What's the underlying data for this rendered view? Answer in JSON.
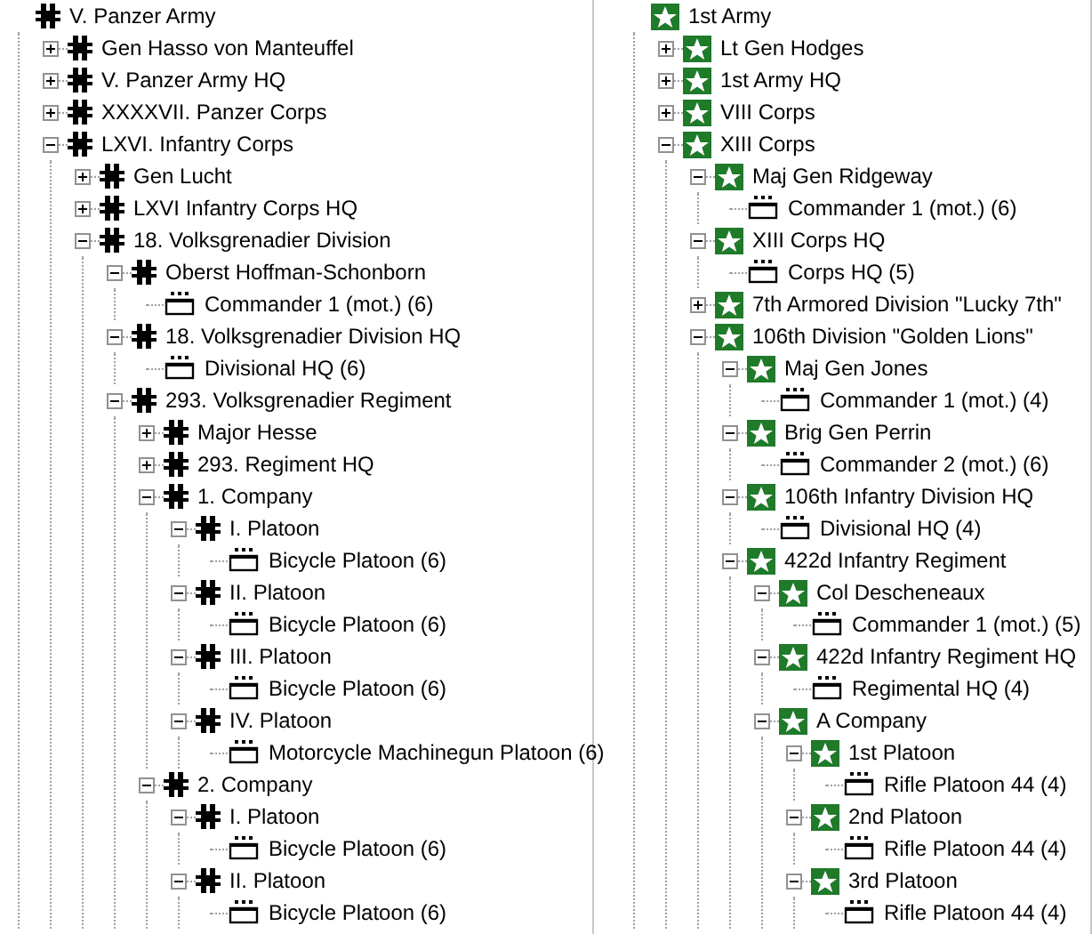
{
  "panes": [
    {
      "tree": {
        "label": "V. Panzer Army",
        "kind": "german",
        "children": [
          {
            "label": "Gen Hasso von Manteuffel",
            "kind": "german",
            "expanded": false
          },
          {
            "label": "V. Panzer Army HQ",
            "kind": "german",
            "expanded": false
          },
          {
            "label": "XXXXVII. Panzer Corps",
            "kind": "german",
            "expanded": false
          },
          {
            "label": "LXVI. Infantry Corps",
            "kind": "german",
            "expanded": true,
            "children": [
              {
                "label": "Gen Lucht",
                "kind": "german",
                "expanded": false
              },
              {
                "label": "LXVI Infantry Corps HQ",
                "kind": "german",
                "expanded": false
              },
              {
                "label": "18. Volksgrenadier Division",
                "kind": "german",
                "expanded": true,
                "children": [
                  {
                    "label": "Oberst Hoffman-Schonborn",
                    "kind": "german",
                    "expanded": true,
                    "children": [
                      {
                        "label": "Commander 1 (mot.) (6)",
                        "kind": "unit"
                      }
                    ]
                  },
                  {
                    "label": "18. Volksgrenadier Division HQ",
                    "kind": "german",
                    "expanded": true,
                    "children": [
                      {
                        "label": "Divisional HQ (6)",
                        "kind": "unit"
                      }
                    ]
                  },
                  {
                    "label": "293. Volksgrenadier Regiment",
                    "kind": "german",
                    "expanded": true,
                    "children": [
                      {
                        "label": "Major Hesse",
                        "kind": "german",
                        "expanded": false
                      },
                      {
                        "label": "293. Regiment HQ",
                        "kind": "german",
                        "expanded": false
                      },
                      {
                        "label": "1. Company",
                        "kind": "german",
                        "expanded": true,
                        "children": [
                          {
                            "label": "I. Platoon",
                            "kind": "german",
                            "expanded": true,
                            "children": [
                              {
                                "label": "Bicycle Platoon (6)",
                                "kind": "unit"
                              }
                            ]
                          },
                          {
                            "label": "II. Platoon",
                            "kind": "german",
                            "expanded": true,
                            "children": [
                              {
                                "label": "Bicycle Platoon (6)",
                                "kind": "unit"
                              }
                            ]
                          },
                          {
                            "label": "III. Platoon",
                            "kind": "german",
                            "expanded": true,
                            "children": [
                              {
                                "label": "Bicycle Platoon (6)",
                                "kind": "unit"
                              }
                            ]
                          },
                          {
                            "label": "IV. Platoon",
                            "kind": "german",
                            "expanded": true,
                            "children": [
                              {
                                "label": "Motorcycle Machinegun Platoon (6)",
                                "kind": "unit"
                              }
                            ]
                          }
                        ]
                      },
                      {
                        "label": "2. Company",
                        "kind": "german",
                        "expanded": true,
                        "children": [
                          {
                            "label": "I. Platoon",
                            "kind": "german",
                            "expanded": true,
                            "children": [
                              {
                                "label": "Bicycle Platoon (6)",
                                "kind": "unit"
                              }
                            ]
                          },
                          {
                            "label": "II. Platoon",
                            "kind": "german",
                            "expanded": true,
                            "children": [
                              {
                                "label": "Bicycle Platoon (6)",
                                "kind": "unit"
                              }
                            ]
                          }
                        ]
                      }
                    ]
                  }
                ]
              }
            ]
          }
        ]
      }
    },
    {
      "tree": {
        "label": "1st Army",
        "kind": "us",
        "children": [
          {
            "label": "Lt Gen Hodges",
            "kind": "us",
            "expanded": false
          },
          {
            "label": "1st Army HQ",
            "kind": "us",
            "expanded": false
          },
          {
            "label": "VIII Corps",
            "kind": "us",
            "expanded": false
          },
          {
            "label": "XIII Corps",
            "kind": "us",
            "expanded": true,
            "children": [
              {
                "label": "Maj Gen Ridgeway",
                "kind": "us",
                "expanded": true,
                "children": [
                  {
                    "label": "Commander 1 (mot.) (6)",
                    "kind": "unit"
                  }
                ]
              },
              {
                "label": "XIII Corps HQ",
                "kind": "us",
                "expanded": true,
                "children": [
                  {
                    "label": "Corps HQ (5)",
                    "kind": "unit"
                  }
                ]
              },
              {
                "label": "7th Armored Division \"Lucky 7th\"",
                "kind": "us",
                "expanded": false
              },
              {
                "label": "106th Division \"Golden Lions\"",
                "kind": "us",
                "expanded": true,
                "children": [
                  {
                    "label": "Maj Gen Jones",
                    "kind": "us",
                    "expanded": true,
                    "children": [
                      {
                        "label": "Commander 1 (mot.) (4)",
                        "kind": "unit"
                      }
                    ]
                  },
                  {
                    "label": "Brig Gen Perrin",
                    "kind": "us",
                    "expanded": true,
                    "children": [
                      {
                        "label": "Commander 2 (mot.) (6)",
                        "kind": "unit"
                      }
                    ]
                  },
                  {
                    "label": "106th Infantry Division HQ",
                    "kind": "us",
                    "expanded": true,
                    "children": [
                      {
                        "label": "Divisional HQ (4)",
                        "kind": "unit"
                      }
                    ]
                  },
                  {
                    "label": "422d Infantry Regiment",
                    "kind": "us",
                    "expanded": true,
                    "children": [
                      {
                        "label": "Col Descheneaux",
                        "kind": "us",
                        "expanded": true,
                        "children": [
                          {
                            "label": "Commander 1 (mot.) (5)",
                            "kind": "unit"
                          }
                        ]
                      },
                      {
                        "label": "422d Infantry Regiment HQ",
                        "kind": "us",
                        "expanded": true,
                        "children": [
                          {
                            "label": "Regimental HQ (4)",
                            "kind": "unit"
                          }
                        ]
                      },
                      {
                        "label": "A Company",
                        "kind": "us",
                        "expanded": true,
                        "children": [
                          {
                            "label": "1st Platoon",
                            "kind": "us",
                            "expanded": true,
                            "children": [
                              {
                                "label": "Rifle Platoon 44 (4)",
                                "kind": "unit"
                              }
                            ]
                          },
                          {
                            "label": "2nd Platoon",
                            "kind": "us",
                            "expanded": true,
                            "children": [
                              {
                                "label": "Rifle Platoon 44 (4)",
                                "kind": "unit"
                              }
                            ]
                          },
                          {
                            "label": "3rd Platoon",
                            "kind": "us",
                            "expanded": true,
                            "children": [
                              {
                                "label": "Rifle Platoon 44 (4)",
                                "kind": "unit"
                              }
                            ]
                          }
                        ]
                      }
                    ]
                  }
                ]
              }
            ]
          }
        ]
      }
    }
  ]
}
